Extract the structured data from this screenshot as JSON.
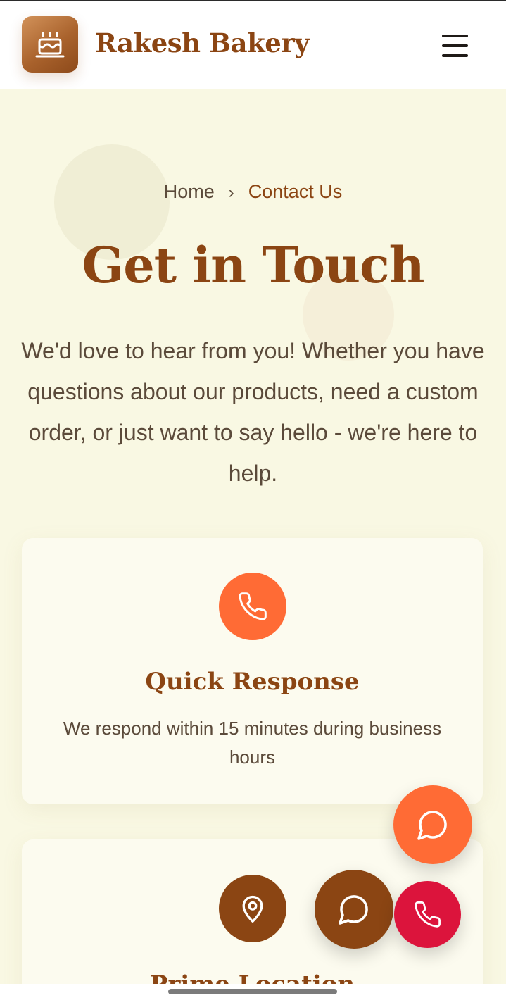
{
  "header": {
    "brand": "Rakesh Bakery",
    "logo_icon": "cake-icon",
    "menu_icon": "hamburger-menu-icon"
  },
  "breadcrumb": {
    "home": "Home",
    "separator_icon": "chevron-right-icon",
    "current": "Contact Us"
  },
  "hero": {
    "title": "Get in Touch",
    "intro": "We'd love to hear from you! Whether you have questions about our products, need a custom order, or just want to say hello - we're here to help."
  },
  "features": [
    {
      "icon": "phone-icon",
      "title": "Quick Response",
      "text": "We respond within 15 minutes during business hours"
    },
    {
      "icon": "location-pin-icon",
      "title": "Prime Location"
    }
  ],
  "floating_buttons": [
    {
      "icon": "chat-icon",
      "color": "#ff6b35"
    },
    {
      "icon": "chat-icon",
      "color": "#8b4513"
    },
    {
      "icon": "phone-icon",
      "color": "#dc143c"
    }
  ],
  "colors": {
    "brand": "#8b4513",
    "accent": "#ff6b35",
    "call": "#dc143c",
    "background": "#f9f8e3"
  }
}
